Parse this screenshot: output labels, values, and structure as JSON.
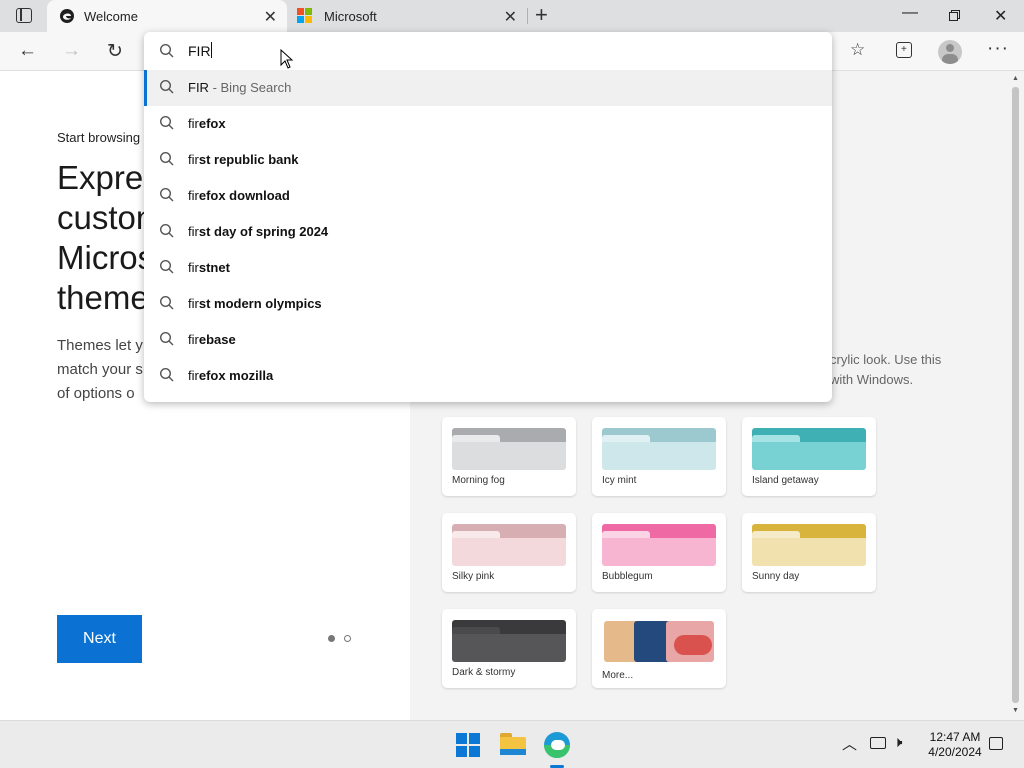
{
  "tabs": [
    {
      "title": "Welcome",
      "icon": "edge-icon"
    },
    {
      "title": "Microsoft",
      "icon": "microsoft-logo-icon"
    }
  ],
  "address": {
    "value": "FIR"
  },
  "suggestions": [
    {
      "prefix": "FIR",
      "rest": "",
      "suffix": " - Bing Search"
    },
    {
      "prefix": "fir",
      "rest": "efox",
      "suffix": ""
    },
    {
      "prefix": "fir",
      "rest": "st republic bank",
      "suffix": ""
    },
    {
      "prefix": "fir",
      "rest": "efox download",
      "suffix": ""
    },
    {
      "prefix": "fir",
      "rest": "st day of spring 2024",
      "suffix": ""
    },
    {
      "prefix": "fir",
      "rest": "stnet",
      "suffix": ""
    },
    {
      "prefix": "fir",
      "rest": "st modern olympics",
      "suffix": ""
    },
    {
      "prefix": "fir",
      "rest": "ebase",
      "suffix": ""
    },
    {
      "prefix": "fir",
      "rest": "efox mozilla",
      "suffix": ""
    }
  ],
  "welcome": {
    "eyebrow": "Start browsing",
    "heading_lines": [
      "Expres",
      "custon",
      "Micros",
      "theme"
    ],
    "body_lines": [
      "Themes let y",
      "match your s",
      "of options o"
    ],
    "next_label": "Next",
    "right_desc_lines": [
      "crylic look. Use this",
      "with Windows."
    ]
  },
  "themes": [
    {
      "name": "Morning fog",
      "top": "#a9abae",
      "body": "#dcdddf",
      "mid": "#e9eaeb"
    },
    {
      "name": "Icy mint",
      "top": "#9cc9d0",
      "body": "#cde7ea",
      "mid": "#e1f1f3"
    },
    {
      "name": "Island getaway",
      "top": "#3fb0b4",
      "body": "#78d2d4",
      "mid": "#a5e3e4"
    },
    {
      "name": "Silky pink",
      "top": "#d7aeb2",
      "body": "#f3d9db",
      "mid": "#f8e9ea"
    },
    {
      "name": "Bubblegum",
      "top": "#ef6aa5",
      "body": "#f7b5d2",
      "mid": "#fbd4e5"
    },
    {
      "name": "Sunny day",
      "top": "#d9b43c",
      "body": "#f0e1ae",
      "mid": "#f6ebc8"
    },
    {
      "name": "Dark & stormy",
      "top": "#3a3a3c",
      "body": "#565658",
      "mid": "#4a4a4c"
    },
    {
      "name": "More..."
    }
  ],
  "taskbar": {
    "time": "12:47 AM",
    "date": "4/20/2024"
  },
  "colors": {
    "accent": "#0b72d4",
    "tabstrip": "#dedfe1",
    "toolbar": "#f7f7f7",
    "highlight": "#f0f0f0"
  }
}
